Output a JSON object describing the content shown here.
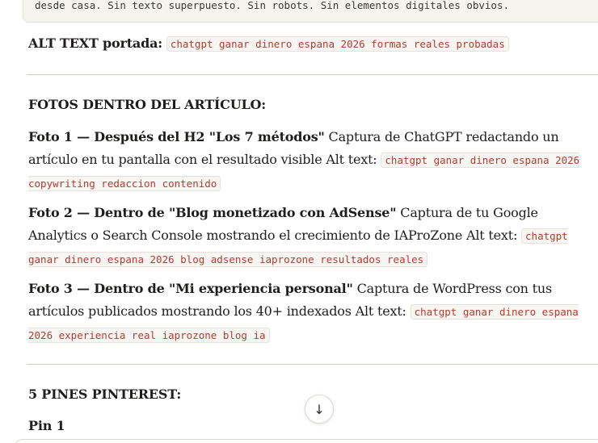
{
  "code_block": {
    "text": "desde casa. Sin texto superpuesto. Sin robots. Sin elementos digitales obvios."
  },
  "alt_portada": {
    "label": "ALT TEXT portada:",
    "code": "chatgpt ganar dinero espana 2026 formas reales probadas"
  },
  "fotos": {
    "heading": "FOTOS DENTRO DEL ARTÍCULO:",
    "items": [
      {
        "title": "Foto 1 — Después del H2 \"Los 7 métodos\"",
        "desc": " Captura de ChatGPT redactando un artículo en tu pantalla con el resultado visible Alt text: ",
        "code": "chatgpt ganar dinero espana 2026 copywriting redaccion contenido"
      },
      {
        "title": "Foto 2 — Dentro de \"Blog monetizado con AdSense\"",
        "desc": " Captura de tu Google Analytics o Search Console mostrando el crecimiento de IAProZone Alt text: ",
        "code": "chatgpt ganar dinero espana 2026 blog adsense iaprozone resultados reales"
      },
      {
        "title": "Foto 3 — Dentro de \"Mi experiencia personal\"",
        "desc": " Captura de WordPress con tus artículos publicados mostrando los 40+ indexados Alt text: ",
        "code": "chatgpt ganar dinero espana 2026 experiencia real iaprozone blog ia"
      }
    ]
  },
  "pines": {
    "heading": "5 PINES PINTEREST:",
    "pin1": "Pin 1"
  },
  "scroll_button": {
    "icon": "arrow-down-icon",
    "glyph": "↓"
  }
}
